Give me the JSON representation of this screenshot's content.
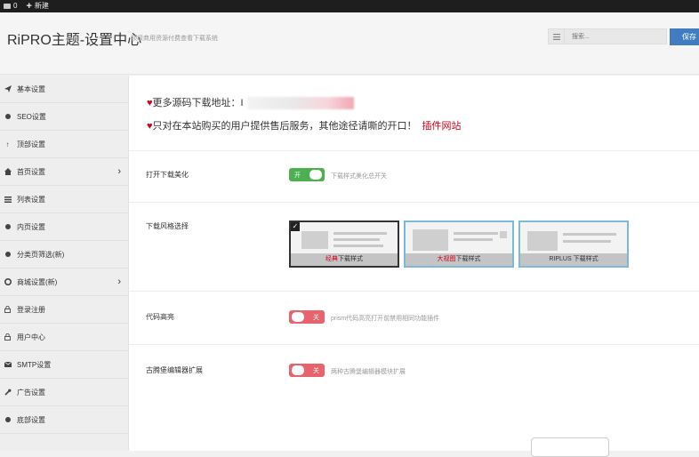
{
  "adminbar": {
    "comments_count": "0",
    "new_label": "新建"
  },
  "header": {
    "title": "RiPRO主题-设置中心",
    "subtitle": "顶级商用资源付费查看下载系统",
    "search_placeholder": "搜索...",
    "save_label": "保存"
  },
  "sidebar": {
    "items": [
      {
        "label": "基本设置",
        "icon": "paper-plane-icon"
      },
      {
        "label": "SEO设置",
        "icon": "dot-icon"
      },
      {
        "label": "顶部设置",
        "icon": "arrow-up-icon"
      },
      {
        "label": "首页设置",
        "icon": "home-icon",
        "has_children": true
      },
      {
        "label": "列表设置",
        "icon": "list-icon"
      },
      {
        "label": "内页设置",
        "icon": "dot-icon"
      },
      {
        "label": "分类页筛选(新)",
        "icon": "dot-icon"
      },
      {
        "label": "商城设置(新)",
        "icon": "gear-icon",
        "has_children": true
      },
      {
        "label": "登录注册",
        "icon": "lock-icon"
      },
      {
        "label": "用户中心",
        "icon": "lock-icon"
      },
      {
        "label": "SMTP设置",
        "icon": "envelope-icon"
      },
      {
        "label": "广告设置",
        "icon": "wrench-icon"
      },
      {
        "label": "底部设置",
        "icon": "dot-icon"
      }
    ],
    "chevron": "›"
  },
  "notice": {
    "line1": "更多源码下载地址：",
    "line1_suffix": "I",
    "line2": "只对在本站购买的用户提供售后服务，其他途径请嘶的开口！",
    "plugin_link": "插件网站"
  },
  "settings": {
    "download_beautify": {
      "label": "打开下载美化",
      "toggle_text": "开",
      "enabled": true,
      "description": "下载样式美化总开关"
    },
    "download_style": {
      "label": "下载风格选择",
      "options": [
        {
          "caption_red": "经典",
          "caption": "下载样式",
          "selected": true
        },
        {
          "caption_red": "大视图",
          "caption": "下载样式",
          "selected": false
        },
        {
          "caption_red": "",
          "caption": "RIPLUS 下载样式",
          "selected": false
        }
      ]
    },
    "code_highlight": {
      "label": "代码高亮",
      "toggle_text": "关",
      "enabled": false,
      "description": "prism代码高亮打开前禁用相同功能插件"
    },
    "gutenberg": {
      "label": "古腾堡编辑器扩展",
      "toggle_text": "关",
      "enabled": false,
      "description": "两种古腾堡编辑器模块扩展"
    }
  },
  "colors": {
    "save_blue": "#3f7dc0",
    "toggle_on": "#4cb050",
    "toggle_off": "#e8636b",
    "heart_red": "#d0021b"
  }
}
